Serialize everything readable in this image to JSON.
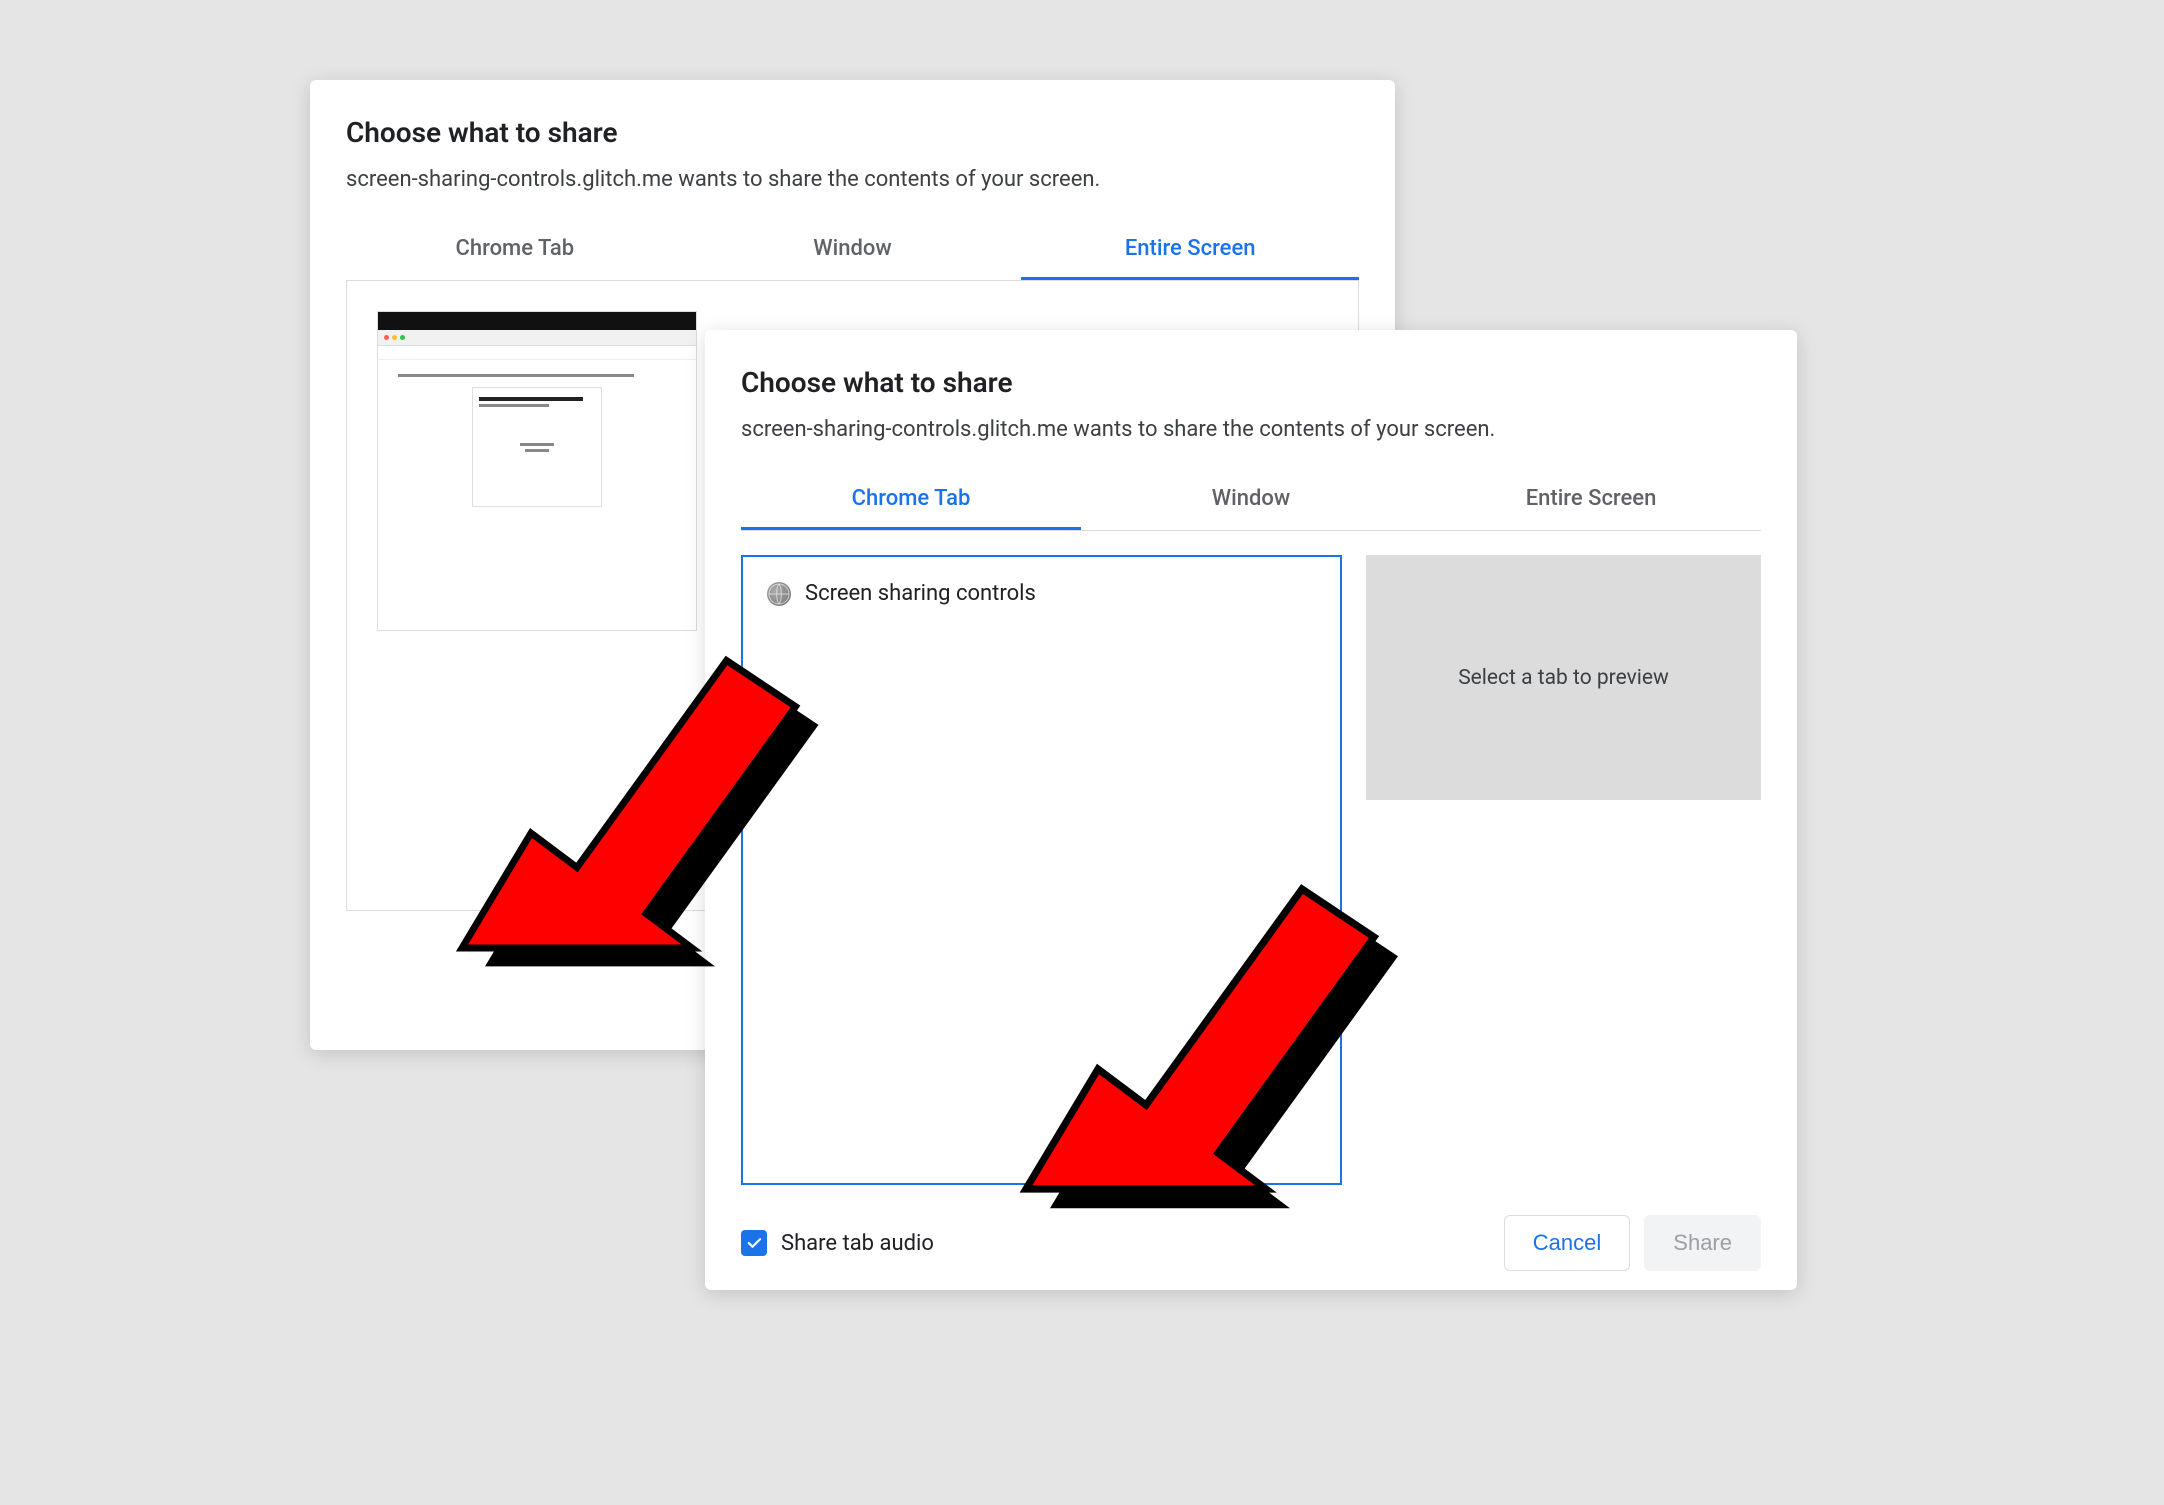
{
  "dialog_back": {
    "title": "Choose what to share",
    "subtitle": "screen-sharing-controls.glitch.me wants to share the contents of your screen.",
    "tabs": [
      "Chrome Tab",
      "Window",
      "Entire Screen"
    ],
    "active_tab_index": 2
  },
  "dialog_front": {
    "title": "Choose what to share",
    "subtitle": "screen-sharing-controls.glitch.me wants to share the contents of your screen.",
    "tabs": [
      "Chrome Tab",
      "Window",
      "Entire Screen"
    ],
    "active_tab_index": 0,
    "tab_items": [
      {
        "label": "Screen sharing controls"
      }
    ],
    "preview_placeholder": "Select a tab to preview",
    "share_audio_label": "Share tab audio",
    "share_audio_checked": true,
    "cancel_label": "Cancel",
    "share_label": "Share"
  }
}
